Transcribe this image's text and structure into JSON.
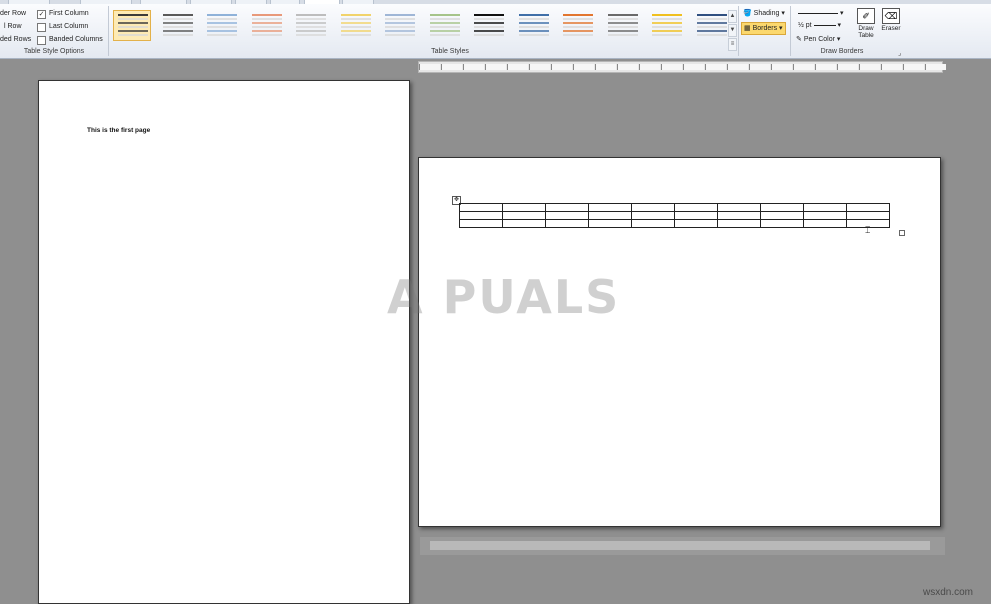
{
  "table_style_options": {
    "group_label": "Table Style Options",
    "left_items": [
      "der Row",
      "l Row",
      "ded Rows"
    ],
    "right_items": [
      {
        "label": "First Column",
        "checked": true
      },
      {
        "label": "Last Column",
        "checked": false
      },
      {
        "label": "Banded Columns",
        "checked": false
      }
    ]
  },
  "table_styles": {
    "group_label": "Table Styles",
    "thumbnails": [
      {
        "color": "#3b3b3b",
        "selected": true
      },
      {
        "color": "#5a5a5a",
        "selected": false
      },
      {
        "color": "#8fb2d9",
        "selected": false
      },
      {
        "color": "#e8997a",
        "selected": false
      },
      {
        "color": "#bdbdbd",
        "selected": false
      },
      {
        "color": "#f1d36b",
        "selected": false
      },
      {
        "color": "#9fb6d6",
        "selected": false
      },
      {
        "color": "#a6c48a",
        "selected": false
      },
      {
        "color": "#111111",
        "selected": false
      },
      {
        "color": "#3f6fa8",
        "selected": false
      },
      {
        "color": "#e2762f",
        "selected": false
      },
      {
        "color": "#6a6a6a",
        "selected": false
      },
      {
        "color": "#f0c020",
        "selected": false
      },
      {
        "color": "#2f4f80",
        "selected": false
      }
    ],
    "scroll_icons": [
      "up",
      "down",
      "more"
    ]
  },
  "draw_borders": {
    "group_label": "Draw Borders",
    "shading_label": "Shading",
    "borders_label": "Borders",
    "pen_weight_label": "½ pt",
    "pen_color_label": "Pen Color",
    "draw_table_label": "Draw Table",
    "eraser_label": "Eraser"
  },
  "document": {
    "first_page_text": "This is the first page",
    "table": {
      "rows": 3,
      "cols": 10
    }
  },
  "watermark": {
    "text": "A PUALS"
  },
  "site_mark": {
    "text": "wsxdn.com"
  }
}
